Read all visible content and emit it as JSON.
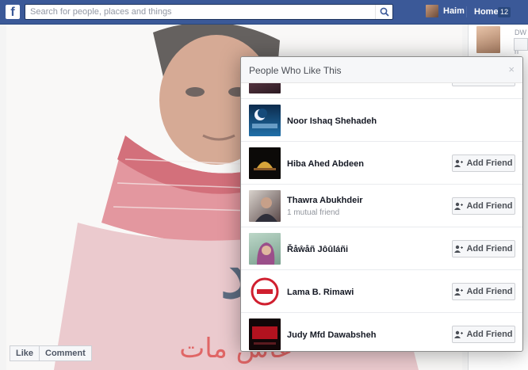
{
  "topbar": {
    "logo": "f",
    "search_placeholder": "Search for people, places and things",
    "user_name": "Haim",
    "home_label": "Home",
    "home_count": "12",
    "brand_color": "#3b5998"
  },
  "right_column": {
    "text_1": "DW",
    "text_2": "50 n"
  },
  "photo": {
    "arabic_caption": "عاش مات",
    "arabic_title": "هند"
  },
  "photo_actions": {
    "like_label": "Like",
    "comment_label": "Comment"
  },
  "dialog": {
    "title": "People Who Like This",
    "close_label": "×",
    "add_friend_label": "Add Friend",
    "people": [
      {
        "name": "",
        "sub": "",
        "avatar": "partial-thumb-icon",
        "has_button": true
      },
      {
        "name": "Noor Ishaq Shehadeh",
        "sub": "",
        "avatar": "ramadan-crescent-thumb-icon",
        "has_button": false
      },
      {
        "name": "Hiba Ahed Abdeen",
        "sub": "",
        "avatar": "dome-night-thumb-icon",
        "has_button": true
      },
      {
        "name": "Thawra Abukhdeir",
        "sub": "1 mutual friend",
        "avatar": "woman-photo-thumb-icon",
        "has_button": true
      },
      {
        "name": "Řåŵåñ Jôûláñi",
        "sub": "",
        "avatar": "woman-scarf-thumb-icon",
        "has_button": true
      },
      {
        "name": "Lama B. Rimawi",
        "sub": "",
        "avatar": "red-logo-thumb-icon",
        "has_button": true
      },
      {
        "name": "Judy Mfd Dawabsheh",
        "sub": "",
        "avatar": "gaza-text-thumb-icon",
        "has_button": true
      }
    ]
  }
}
